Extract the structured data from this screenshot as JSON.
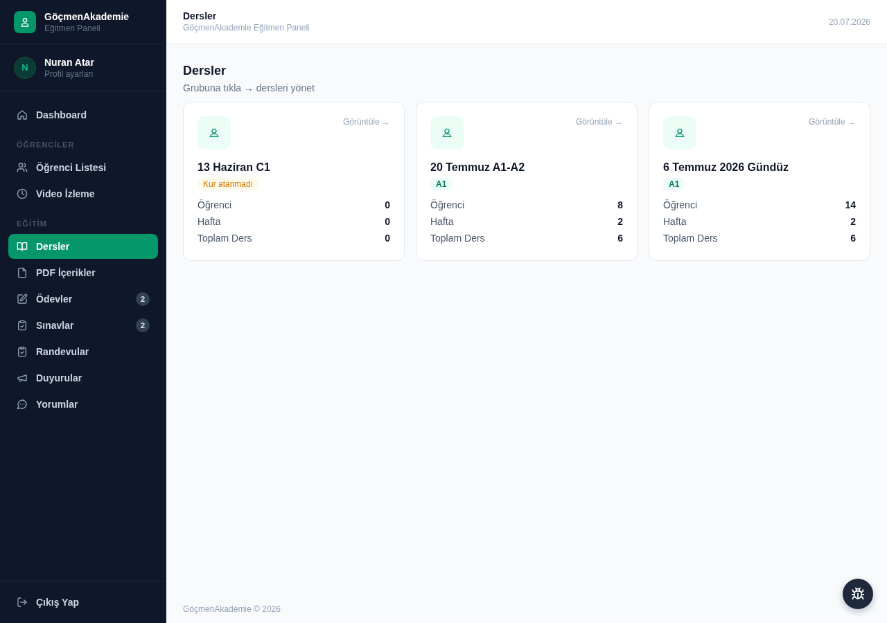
{
  "sidebar": {
    "brand": {
      "title": "GöçmenAkademie",
      "subtitle": "Eğitmen Paneli"
    },
    "profile": {
      "initial": "N",
      "name": "Nuran Atar",
      "subtitle": "Profil ayarları"
    },
    "nav": [
      {
        "items": [
          {
            "label": "Dashboard",
            "selected": false
          }
        ]
      },
      {
        "heading": "ÖĞRENCİLER",
        "items": [
          {
            "label": "Öğrenci Listesi",
            "selected": false
          },
          {
            "label": "Video İzleme",
            "selected": false
          }
        ]
      },
      {
        "heading": "EĞİTİM",
        "items": [
          {
            "label": "Dersler",
            "selected": true
          },
          {
            "label": "PDF İçerikler",
            "selected": false
          },
          {
            "label": "Ödevler",
            "selected": false,
            "badge": "2"
          },
          {
            "label": "Sınavlar",
            "selected": false,
            "badge": "2"
          },
          {
            "label": "Randevular",
            "selected": false
          },
          {
            "label": "Duyurular",
            "selected": false
          },
          {
            "label": "Yorumlar",
            "selected": false
          }
        ]
      }
    ],
    "logout": {
      "label": "Çıkış Yap"
    }
  },
  "header": {
    "title": "Dersler",
    "subtitle": "GöçmenAkademie Eğitmen Paneli",
    "date": "20.07.2026"
  },
  "page": {
    "title": "Dersler",
    "subtitle": "Grubuna tıkla → dersleri yönet"
  },
  "cards": [
    {
      "title": "13 Haziran C1",
      "link": "Görüntüle →",
      "tag": {
        "kind": "warning",
        "text": "Kur atanmadı"
      },
      "stats": [
        {
          "label": "Öğrenci",
          "value": "0"
        },
        {
          "label": "Hafta",
          "value": "0"
        },
        {
          "label": "Toplam Ders",
          "value": "0"
        }
      ]
    },
    {
      "title": "20 Temmuz A1-A2",
      "link": "Görüntüle →",
      "tag": {
        "kind": "level",
        "text": "A1"
      },
      "stats": [
        {
          "label": "Öğrenci",
          "value": "8"
        },
        {
          "label": "Hafta",
          "value": "2"
        },
        {
          "label": "Toplam Ders",
          "value": "6"
        }
      ]
    },
    {
      "title": "6 Temmuz 2026 Gündüz",
      "link": "Görüntüle →",
      "tag": {
        "kind": "level",
        "text": "A1"
      },
      "stats": [
        {
          "label": "Öğrenci",
          "value": "14"
        },
        {
          "label": "Hafta",
          "value": "2"
        },
        {
          "label": "Toplam Ders",
          "value": "6"
        }
      ]
    }
  ],
  "footer": {
    "text": "GöçmenAkademie © 2026"
  }
}
